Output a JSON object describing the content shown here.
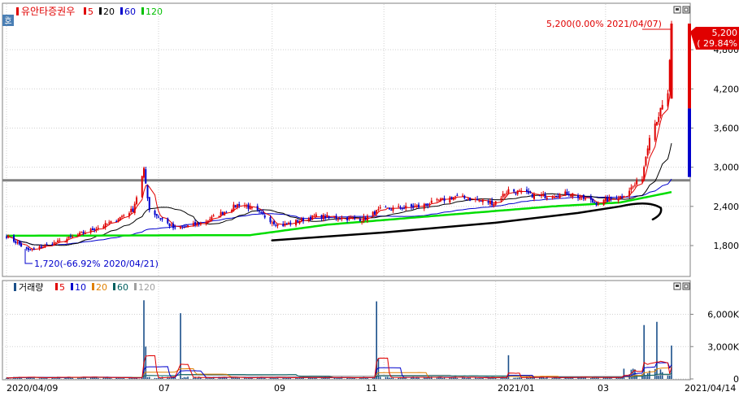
{
  "price_legend": {
    "symbol": "호",
    "name": "유안타증권우",
    "ma": [
      {
        "label": "5",
        "color": "#e00000"
      },
      {
        "label": "20",
        "color": "#000000"
      },
      {
        "label": "60",
        "color": "#0000cc"
      },
      {
        "label": "120",
        "color": "#00c000"
      }
    ]
  },
  "volume_legend": {
    "name": "거래량",
    "ma": [
      {
        "label": "5",
        "color": "#e00000"
      },
      {
        "label": "10",
        "color": "#0000cc"
      },
      {
        "label": "20",
        "color": "#e08000"
      },
      {
        "label": "60",
        "color": "#006060"
      },
      {
        "label": "120",
        "color": "#a0a0a0"
      }
    ]
  },
  "annotations": {
    "high": "5,200(0.00% 2021/04/07)",
    "low": "1,720(-66.92% 2020/04/21)",
    "current_price": "5,200",
    "current_change": "( 29.84%"
  },
  "colors": {
    "up": "#e00000",
    "down": "#0000cc",
    "ma5": "#e00000",
    "ma20": "#000000",
    "ma60": "#0000cc",
    "ma120": "#00dd00",
    "resistance": "#808080",
    "volume": "#1a4f8a"
  },
  "chart_data": [
    {
      "type": "candlestick",
      "name": "유안타증권우",
      "x_start": "2020/04/09",
      "x_end": "2021/04/14",
      "x_ticks": [
        "2020/04/09",
        "07",
        "09",
        "11",
        "2021/01",
        "03",
        "2021/04/14"
      ],
      "y_ticks": [
        "1,800",
        "2,400",
        "3,000",
        "3,600",
        "4,200",
        "4,800"
      ],
      "ylim": [
        1500,
        5400
      ],
      "resistance_level": 2800,
      "support_trendline": [
        {
          "date": "2020/09/01",
          "value": 1880
        },
        {
          "date": "2020/11/01",
          "value": 2000
        },
        {
          "date": "2021/01/01",
          "value": 2150
        },
        {
          "date": "2021/02/15",
          "value": 2300
        },
        {
          "date": "2021/03/10",
          "value": 2400
        }
      ],
      "price_anchors": [
        {
          "date": "2020/04/09",
          "value": 1950
        },
        {
          "date": "2020/04/21",
          "value": 1720
        },
        {
          "date": "2020/05/10",
          "value": 1880
        },
        {
          "date": "2020/06/05",
          "value": 2150
        },
        {
          "date": "2020/06/17",
          "value": 2350
        },
        {
          "date": "2020/06/23",
          "value": 2950
        },
        {
          "date": "2020/06/26",
          "value": 2350
        },
        {
          "date": "2020/07/10",
          "value": 2050
        },
        {
          "date": "2020/07/25",
          "value": 2150
        },
        {
          "date": "2020/08/15",
          "value": 2450
        },
        {
          "date": "2020/08/25",
          "value": 2300
        },
        {
          "date": "2020/09/05",
          "value": 2100
        },
        {
          "date": "2020/09/25",
          "value": 2250
        },
        {
          "date": "2020/10/20",
          "value": 2200
        },
        {
          "date": "2020/10/30",
          "value": 2350
        },
        {
          "date": "2020/11/20",
          "value": 2400
        },
        {
          "date": "2020/12/10",
          "value": 2550
        },
        {
          "date": "2020/12/31",
          "value": 2450
        },
        {
          "date": "2021/01/08",
          "value": 2650
        },
        {
          "date": "2021/01/25",
          "value": 2550
        },
        {
          "date": "2021/02/10",
          "value": 2600
        },
        {
          "date": "2021/02/25",
          "value": 2450
        },
        {
          "date": "2021/03/10",
          "value": 2550
        },
        {
          "date": "2021/03/17",
          "value": 2700
        },
        {
          "date": "2021/03/22",
          "value": 2850
        },
        {
          "date": "2021/03/26",
          "value": 3500
        },
        {
          "date": "2021/03/31",
          "value": 3800
        },
        {
          "date": "2021/04/05",
          "value": 4100
        },
        {
          "date": "2021/04/07",
          "value": 5200
        }
      ],
      "ma120_anchors": [
        {
          "date": "2020/04/09",
          "value": 1950
        },
        {
          "date": "2020/08/20",
          "value": 1960
        },
        {
          "date": "2020/10/01",
          "value": 2120
        },
        {
          "date": "2020/12/01",
          "value": 2260
        },
        {
          "date": "2021/02/01",
          "value": 2400
        },
        {
          "date": "2021/03/10",
          "value": 2460
        },
        {
          "date": "2021/04/07",
          "value": 2620
        }
      ]
    },
    {
      "type": "bar",
      "name": "거래량",
      "y_ticks": [
        "0",
        "3,000K",
        "6,000K"
      ],
      "ylim": [
        0,
        8000
      ],
      "spikes": [
        {
          "date": "2020/06/23",
          "value": 7300
        },
        {
          "date": "2020/06/24",
          "value": 3000
        },
        {
          "date": "2020/07/13",
          "value": 6100
        },
        {
          "date": "2020/10/28",
          "value": 7200
        },
        {
          "date": "2020/10/29",
          "value": 1900
        },
        {
          "date": "2021/01/08",
          "value": 2200
        },
        {
          "date": "2021/03/23",
          "value": 5000
        },
        {
          "date": "2021/03/30",
          "value": 5300
        },
        {
          "date": "2021/04/07",
          "value": 3100
        }
      ]
    }
  ]
}
